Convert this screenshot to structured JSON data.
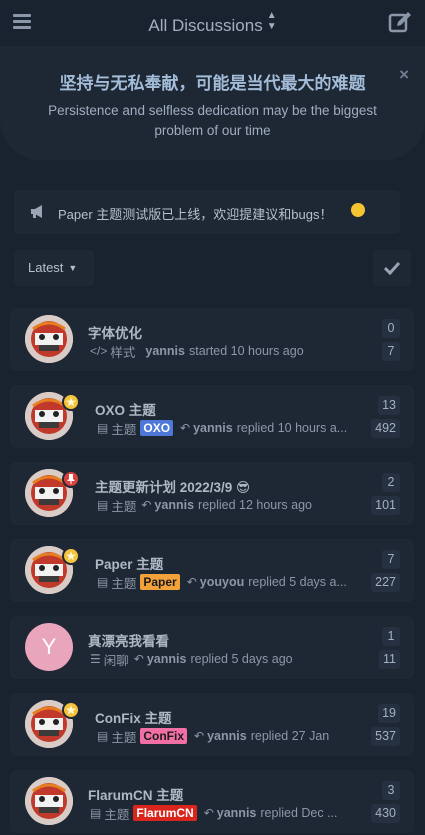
{
  "header": {
    "title": "All Discussions",
    "menu_icon": "hamburger-icon",
    "compose_icon": "pencil-square-icon"
  },
  "hero": {
    "title": "坚持与无私奉献，可能是当代最大的难题",
    "subtitle": "Persistence and selfless dedication may be the biggest problem of our time",
    "close": "×"
  },
  "notice": {
    "text": "Paper 主题测试版已上线，欢迎提建议和bugs！",
    "icon": "megaphone-icon"
  },
  "toolbar": {
    "sort_label": "Latest",
    "mark_read_icon": "check-icon"
  },
  "discussions": [
    {
      "title": "字体优化",
      "tag_icon": "code-icon",
      "tag_name": "样式",
      "tag_label": "",
      "user": "yannis",
      "action": "started 10 hours ago",
      "unread": "0",
      "replies": "7",
      "avatar": "lion-dance",
      "badge": ""
    },
    {
      "title": "OXO 主题",
      "tag_icon": "stripes-icon",
      "tag_name": "主题",
      "tag_label": "OXO",
      "tag_color": "#4d78d8",
      "tag_text_color": "#ffffff",
      "user": "yannis",
      "action": "replied 10 hours a...",
      "unread": "13",
      "replies": "492",
      "avatar": "lion-dance",
      "badge": "star"
    },
    {
      "title": "主题更新计划 2022/3/9 😎",
      "tag_icon": "stripes-icon",
      "tag_name": "主题",
      "tag_label": "",
      "user": "yannis",
      "action": "replied 12 hours ago",
      "unread": "2",
      "replies": "101",
      "avatar": "lion-dance",
      "badge": "pin"
    },
    {
      "title": "Paper 主题",
      "tag_icon": "stripes-icon",
      "tag_name": "主题",
      "tag_label": "Paper",
      "tag_color": "#f3a23b",
      "tag_text_color": "#1a1a1a",
      "user": "youyou",
      "action": "replied 5 days a...",
      "unread": "7",
      "replies": "227",
      "avatar": "lion-dance",
      "badge": "star"
    },
    {
      "title": "真漂亮我看看",
      "tag_icon": "chat-icon",
      "tag_name": "闲聊",
      "tag_label": "",
      "user": "yannis",
      "action": "replied 5 days ago",
      "unread": "1",
      "replies": "11",
      "avatar": "letter",
      "avatar_letter": "Y",
      "badge": ""
    },
    {
      "title": "ConFix 主题",
      "tag_icon": "stripes-icon",
      "tag_name": "主题",
      "tag_label": "ConFix",
      "tag_color": "#f26fa6",
      "tag_text_color": "#1a1a1a",
      "user": "yannis",
      "action": "replied 27 Jan",
      "unread": "19",
      "replies": "537",
      "avatar": "lion-dance",
      "badge": "star"
    },
    {
      "title": "FlarumCN 主题",
      "tag_icon": "stripes-icon",
      "tag_name": "主题",
      "tag_label": "FlarumCN",
      "tag_color": "#d9261c",
      "tag_text_color": "#ffffff",
      "user": "yannis",
      "action": "replied Dec ...",
      "unread": "3",
      "replies": "430",
      "avatar": "lion-dance",
      "badge": ""
    }
  ],
  "colors": {
    "background": "#19222f",
    "surface": "#1e2734",
    "accent_title": "#a3bcd8"
  }
}
